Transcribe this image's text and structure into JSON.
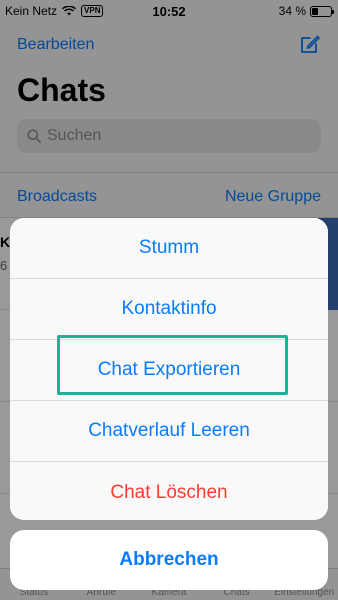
{
  "status_bar": {
    "carrier": "Kein Netz",
    "vpn": "VPN",
    "time": "10:52",
    "battery": "34 %",
    "battery_level": 0.34
  },
  "header": {
    "edit_label": "Bearbeiten",
    "title": "Chats",
    "search_placeholder": "Suchen",
    "broadcasts_label": "Broadcasts",
    "new_group_label": "Neue Gruppe",
    "compose_icon": "compose-icon"
  },
  "chat_list": {
    "rows": [
      {
        "name": "K",
        "subtitle": "6"
      }
    ]
  },
  "action_sheet": {
    "items": [
      {
        "label": "Stumm"
      },
      {
        "label": "Kontaktinfo"
      },
      {
        "label": "Chat Exportieren"
      },
      {
        "label": "Chatverlauf Leeren"
      },
      {
        "label": "Chat Löschen"
      }
    ],
    "cancel_label": "Abbrechen"
  },
  "tab_bar": {
    "items": [
      {
        "label": "Status"
      },
      {
        "label": "Anrufe"
      },
      {
        "label": "Kamera"
      },
      {
        "label": "Chats"
      },
      {
        "label": "Einstellungen"
      }
    ]
  },
  "colors": {
    "accent": "#0a7cff",
    "destructive": "#ff3b30",
    "highlight": "#1ab394"
  }
}
